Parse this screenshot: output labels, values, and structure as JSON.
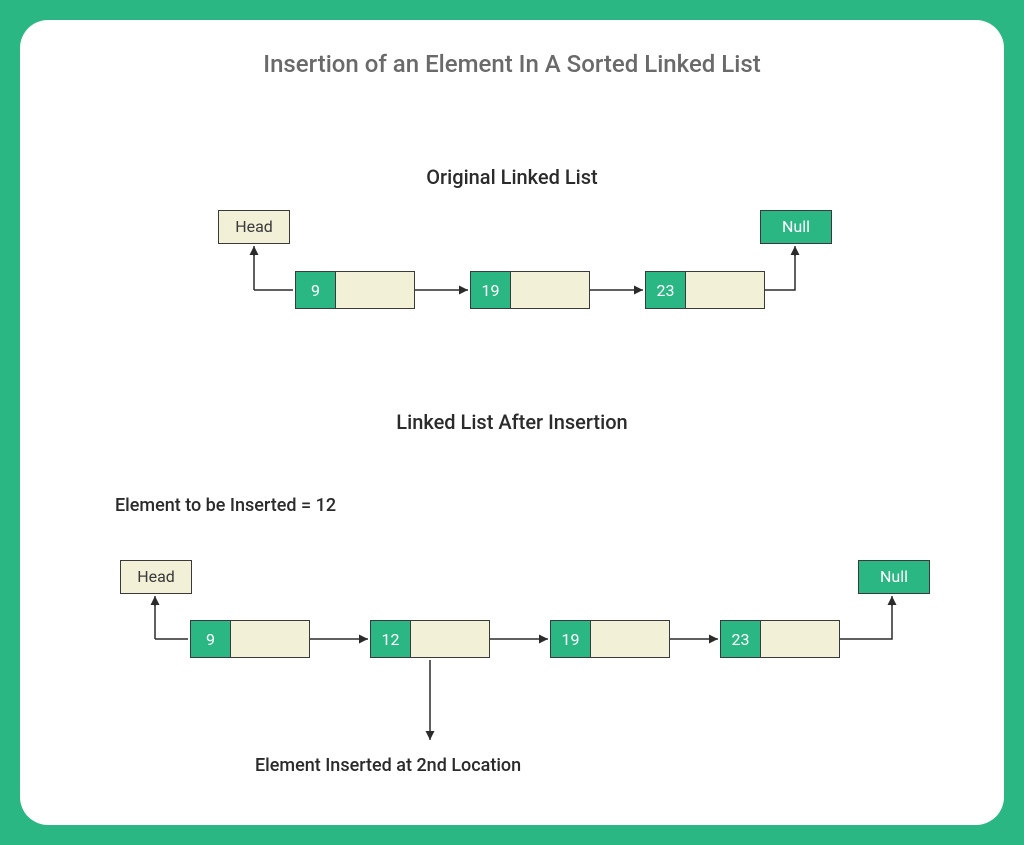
{
  "title": "Insertion of an Element In A Sorted Linked List",
  "section1": {
    "heading": "Original Linked List",
    "head_label": "Head",
    "null_label": "Null",
    "nodes": [
      "9",
      "19",
      "23"
    ]
  },
  "section2": {
    "heading": "Linked List After Insertion",
    "insert_text": "Element to be Inserted = 12",
    "head_label": "Head",
    "null_label": "Null",
    "nodes": [
      "9",
      "12",
      "19",
      "23"
    ],
    "caption": "Element  Inserted at 2nd Location"
  }
}
